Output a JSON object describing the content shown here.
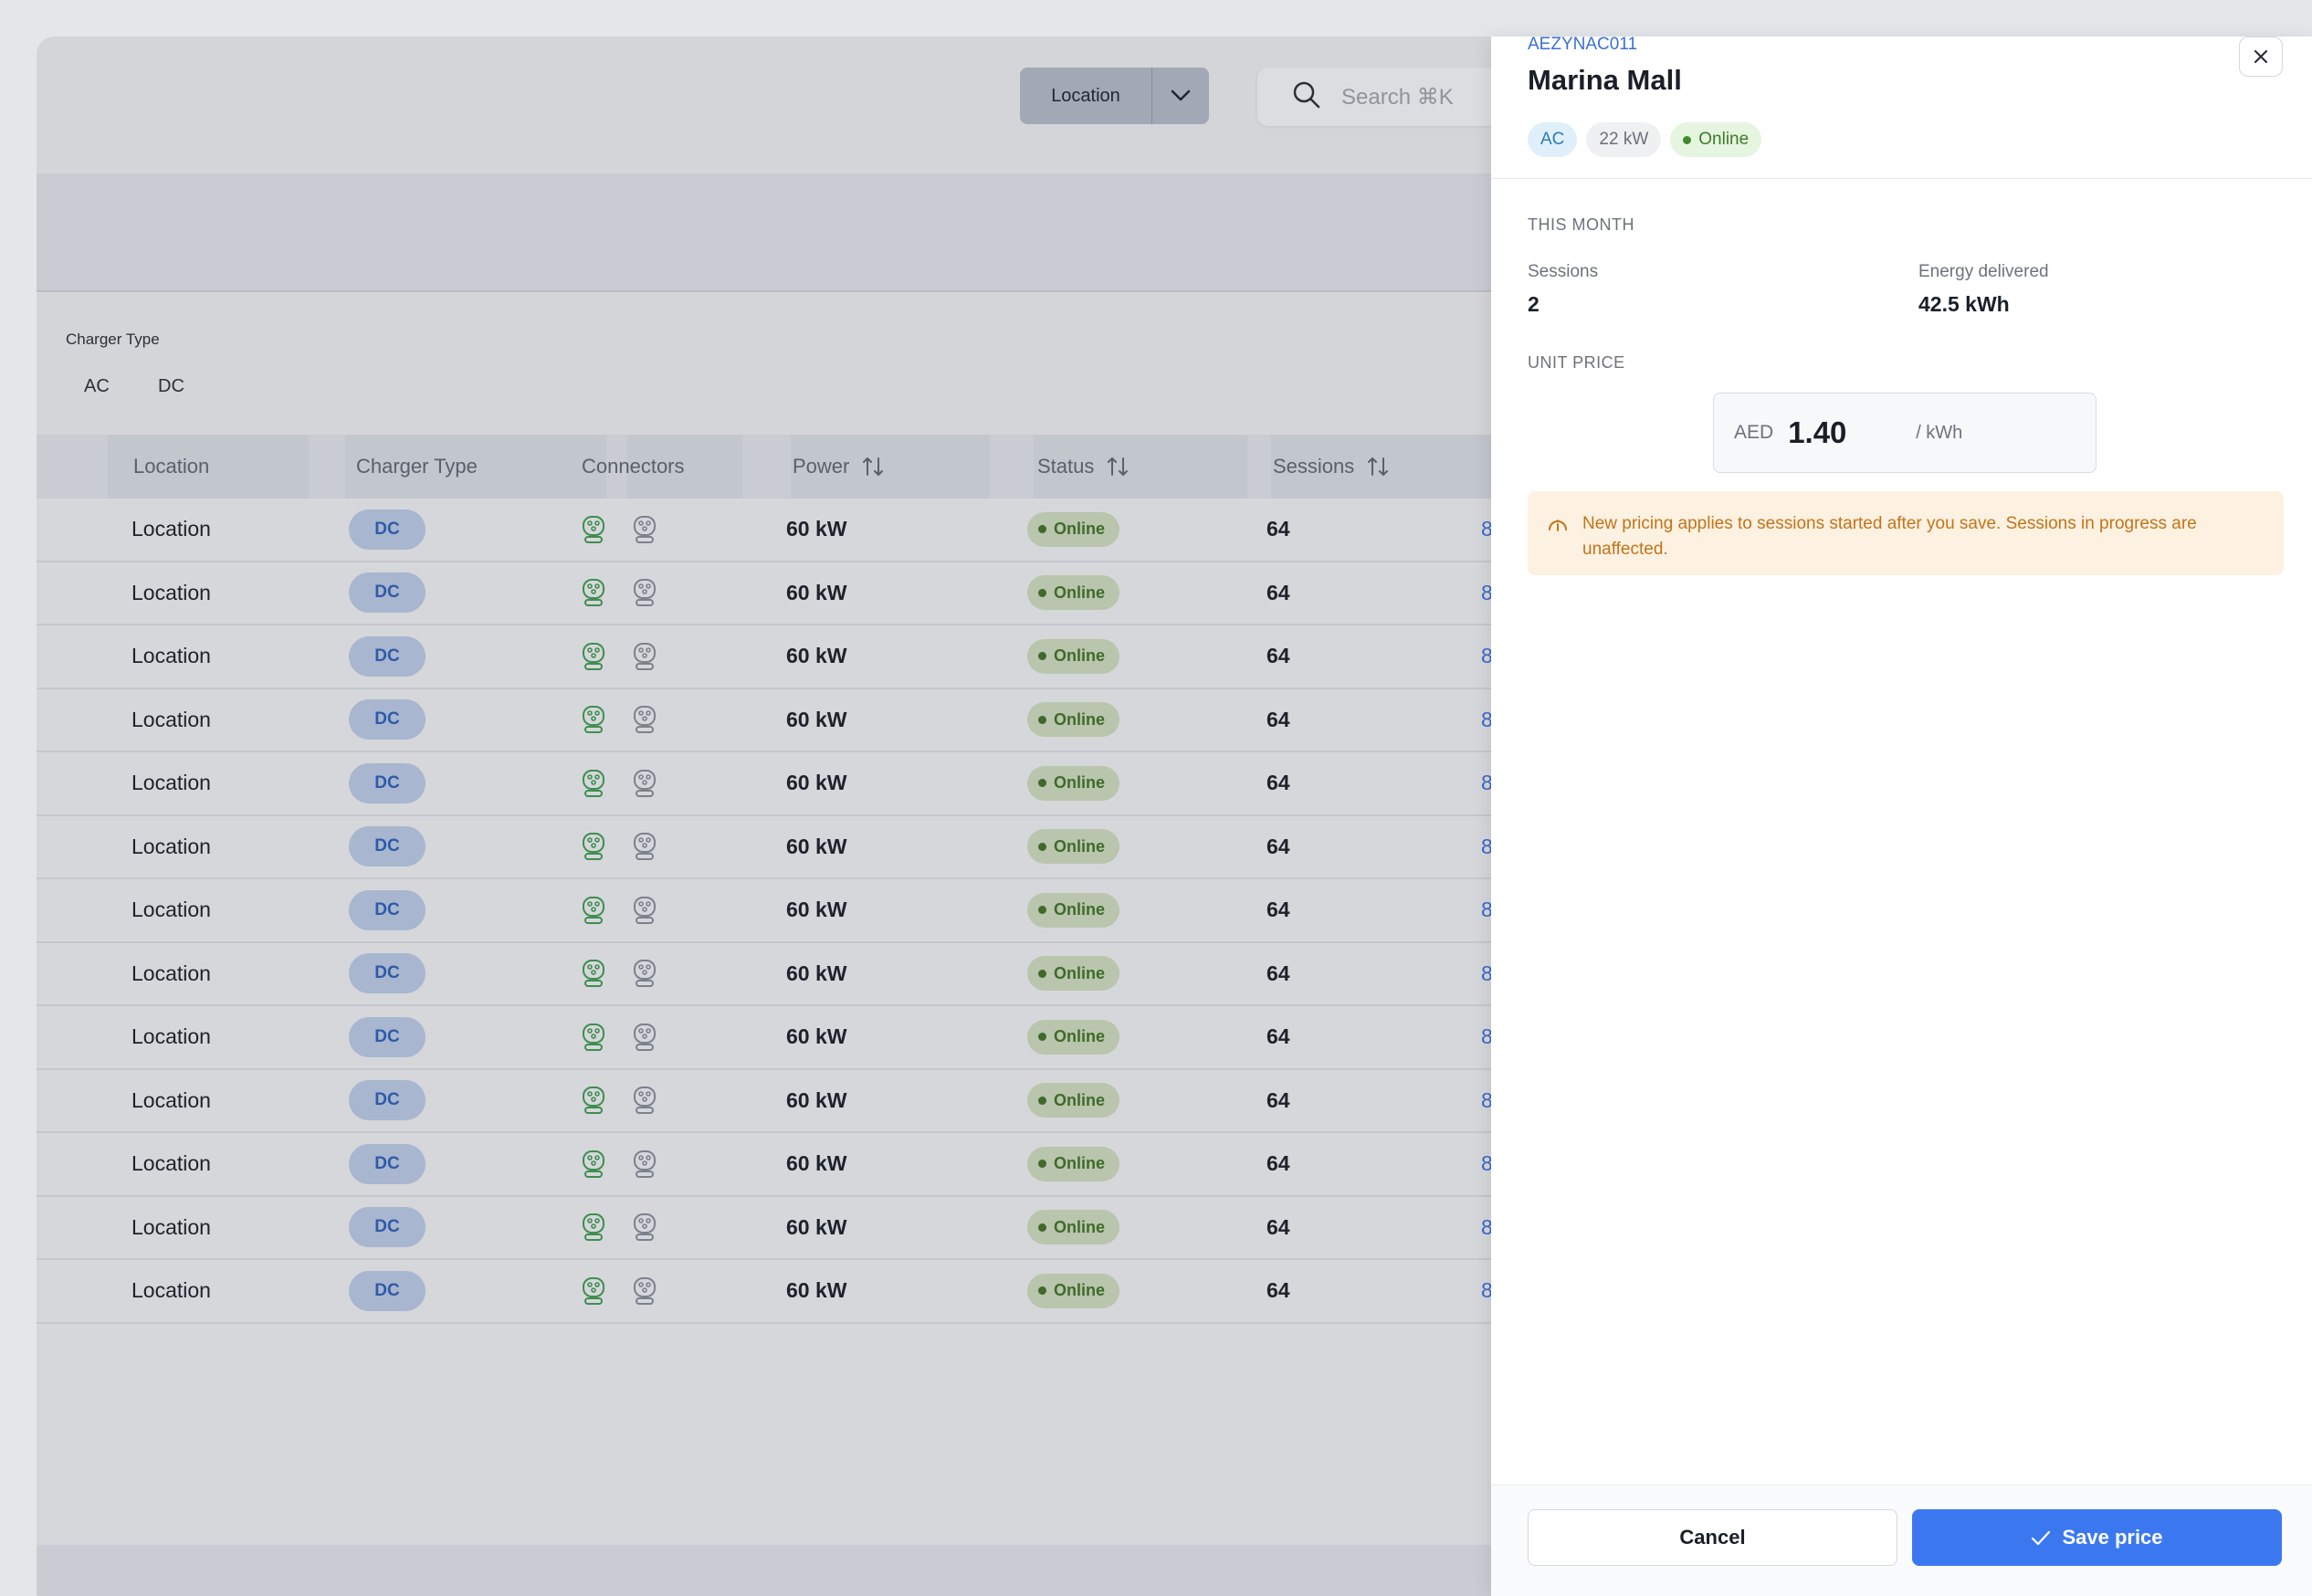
{
  "header": {
    "location_select": "Location",
    "search_placeholder": "Search ⌘K"
  },
  "filters": {
    "title": "Charger Type",
    "options": [
      "AC",
      "DC"
    ]
  },
  "table": {
    "columns": {
      "location": "Location",
      "charger_type": "Charger Type",
      "connectors": "Connectors",
      "power": "Power",
      "status": "Status",
      "sessions": "Sessions"
    },
    "rows": [
      {
        "location": "Location",
        "type": "DC",
        "power": "60 kW",
        "status": "Online",
        "sessions": "64",
        "extra": "8"
      },
      {
        "location": "Location",
        "type": "DC",
        "power": "60 kW",
        "status": "Online",
        "sessions": "64",
        "extra": "8"
      },
      {
        "location": "Location",
        "type": "DC",
        "power": "60 kW",
        "status": "Online",
        "sessions": "64",
        "extra": "8"
      },
      {
        "location": "Location",
        "type": "DC",
        "power": "60 kW",
        "status": "Online",
        "sessions": "64",
        "extra": "8"
      },
      {
        "location": "Location",
        "type": "DC",
        "power": "60 kW",
        "status": "Online",
        "sessions": "64",
        "extra": "8"
      },
      {
        "location": "Location",
        "type": "DC",
        "power": "60 kW",
        "status": "Online",
        "sessions": "64",
        "extra": "8"
      },
      {
        "location": "Location",
        "type": "DC",
        "power": "60 kW",
        "status": "Online",
        "sessions": "64",
        "extra": "8"
      },
      {
        "location": "Location",
        "type": "DC",
        "power": "60 kW",
        "status": "Online",
        "sessions": "64",
        "extra": "8"
      },
      {
        "location": "Location",
        "type": "DC",
        "power": "60 kW",
        "status": "Online",
        "sessions": "64",
        "extra": "8"
      },
      {
        "location": "Location",
        "type": "DC",
        "power": "60 kW",
        "status": "Online",
        "sessions": "64",
        "extra": "8"
      },
      {
        "location": "Location",
        "type": "DC",
        "power": "60 kW",
        "status": "Online",
        "sessions": "64",
        "extra": "8"
      },
      {
        "location": "Location",
        "type": "DC",
        "power": "60 kW",
        "status": "Online",
        "sessions": "64",
        "extra": "8"
      },
      {
        "location": "Location",
        "type": "DC",
        "power": "60 kW",
        "status": "Online",
        "sessions": "64",
        "extra": "8"
      }
    ]
  },
  "drawer": {
    "code": "AEZYNAC011",
    "title": "Marina Mall",
    "tags": {
      "type": "AC",
      "power": "22 kW",
      "status": "Online"
    },
    "this_month_label": "THIS MONTH",
    "sessions_label": "Sessions",
    "sessions_value": "2",
    "energy_label": "Energy delivered",
    "energy_value": "42.5 kWh",
    "unit_price_label": "UNIT PRICE",
    "price": {
      "currency": "AED",
      "amount": "1.40",
      "unit": "/ kWh"
    },
    "note": "New pricing applies to sessions started after you save. Sessions in progress are unaffected.",
    "cancel_label": "Cancel",
    "save_label": "Save price"
  },
  "colors": {
    "accent": "#3b78f0",
    "online_green": "#3f7a2a",
    "warning_text": "#c27419"
  }
}
